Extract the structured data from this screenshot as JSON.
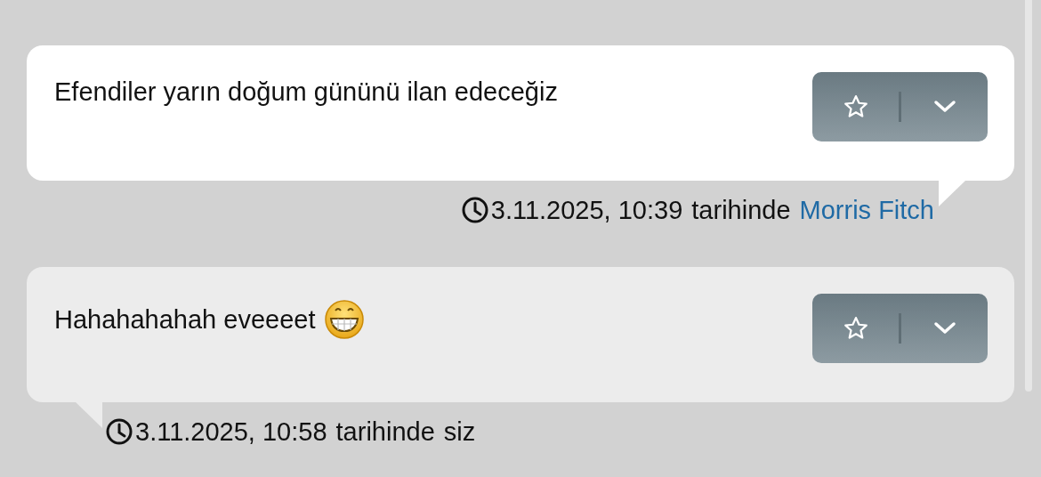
{
  "messages": [
    {
      "text": "Efendiler yarın doğum gününü ilan edeceğiz",
      "own": false,
      "time": "3.11.2025, 10:39",
      "suffix": "tarihinde",
      "author": "Morris Fitch"
    },
    {
      "text": "Hahahahahah eveeeet",
      "own": true,
      "emoji": true,
      "time": "3.11.2025, 10:58",
      "suffix": "tarihinde",
      "author": "siz"
    }
  ]
}
